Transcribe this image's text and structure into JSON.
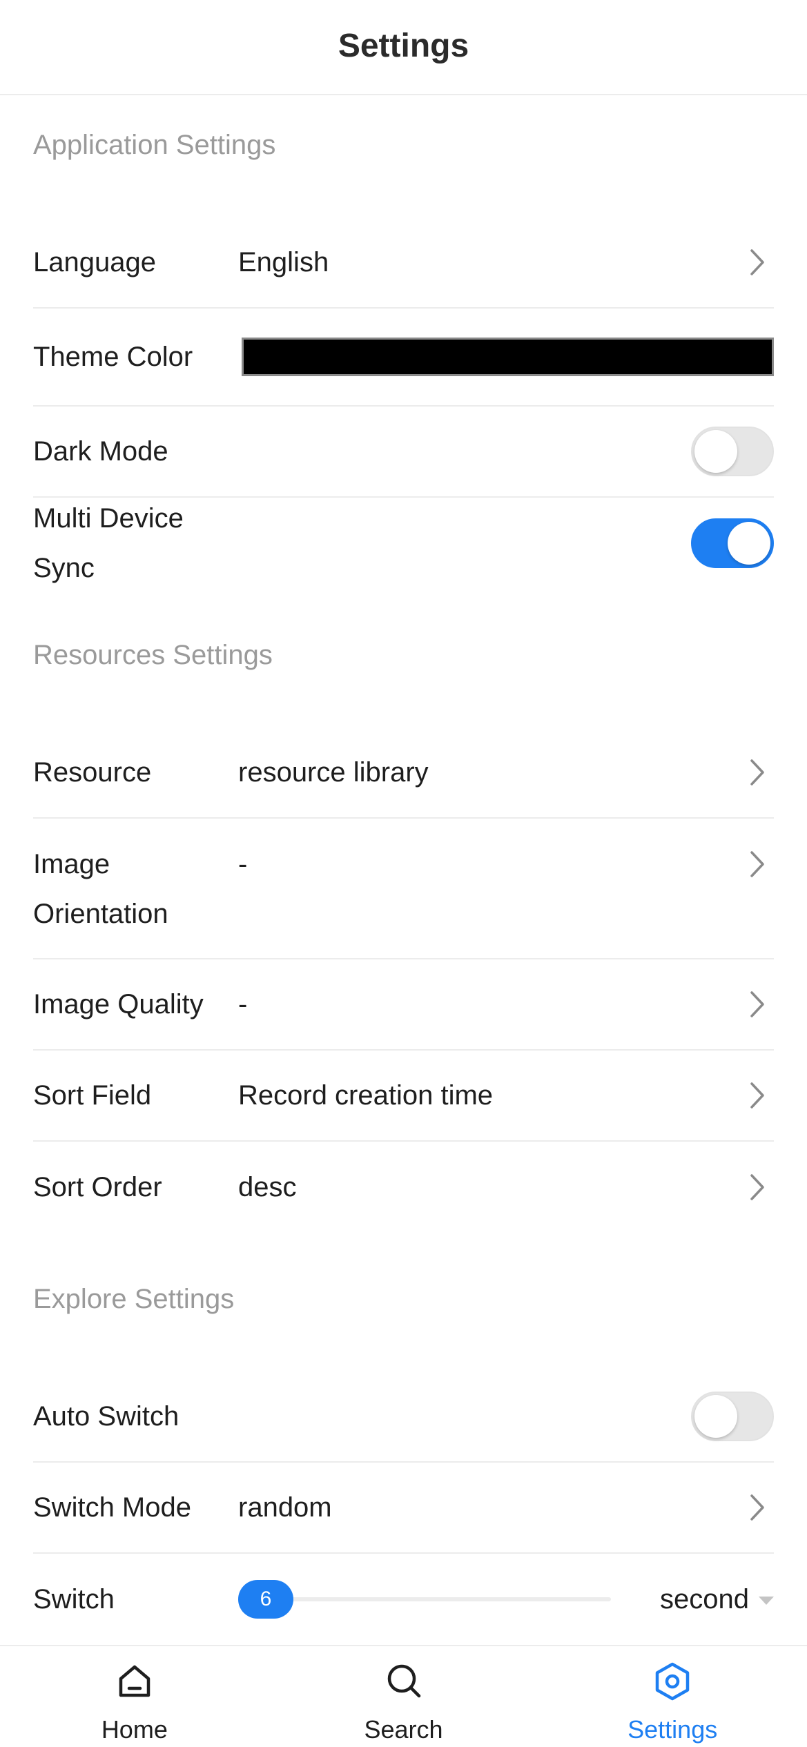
{
  "header": {
    "title": "Settings"
  },
  "sections": {
    "application": {
      "title": "Application Settings",
      "language": {
        "label": "Language",
        "value": "English"
      },
      "theme_color": {
        "label": "Theme Color",
        "value": "#000000"
      },
      "dark_mode": {
        "label": "Dark Mode",
        "on": false
      },
      "multi_device_sync": {
        "label": "Multi Device Sync",
        "on": true
      }
    },
    "resources": {
      "title": "Resources Settings",
      "resource": {
        "label": "Resource",
        "value": "resource library"
      },
      "image_orientation": {
        "label": "Image Orientation",
        "value": "-"
      },
      "image_quality": {
        "label": "Image Quality",
        "value": "-"
      },
      "sort_field": {
        "label": "Sort Field",
        "value": "Record creation time"
      },
      "sort_order": {
        "label": "Sort Order",
        "value": "desc"
      }
    },
    "explore": {
      "title": "Explore Settings",
      "auto_switch": {
        "label": "Auto Switch",
        "on": false
      },
      "switch_mode": {
        "label": "Switch Mode",
        "value": "random"
      },
      "switch_interval": {
        "label": "Switch",
        "value": "6",
        "unit": "second"
      }
    }
  },
  "tabbar": {
    "items": [
      {
        "label": "Home",
        "icon": "home-icon"
      },
      {
        "label": "Search",
        "icon": "search-icon"
      },
      {
        "label": "Settings",
        "icon": "settings-icon",
        "active": true
      }
    ]
  },
  "colors": {
    "accent": "#1e7ff2",
    "section_title": "#9a9a9a",
    "divider": "#ececec"
  }
}
